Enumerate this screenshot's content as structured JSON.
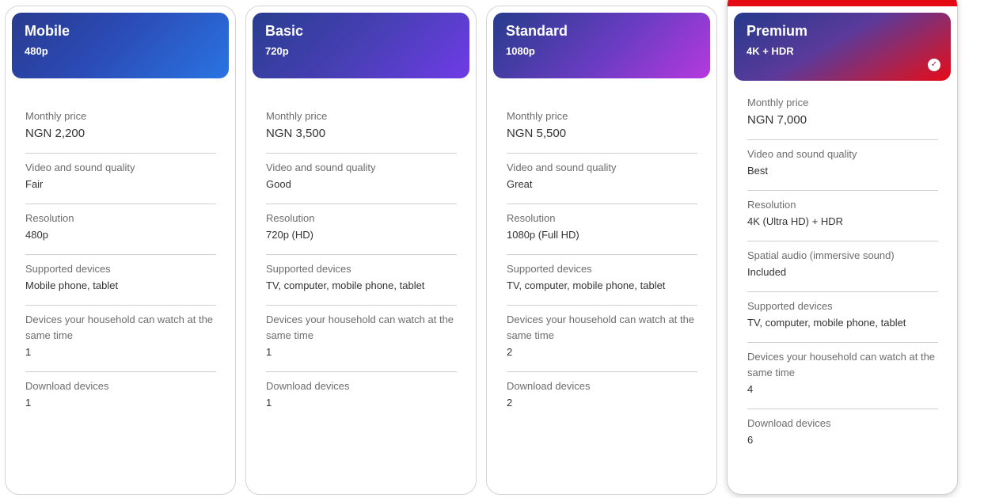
{
  "plans": [
    {
      "name": "Mobile",
      "sub": "480p",
      "price_label": "Monthly price",
      "price": "NGN 2,200",
      "rows": [
        {
          "label": "Video and sound quality",
          "value": "Fair"
        },
        {
          "label": "Resolution",
          "value": "480p"
        },
        {
          "label": "Supported devices",
          "value": "Mobile phone, tablet"
        },
        {
          "label": "Devices your household can watch at the same time",
          "value": "1"
        },
        {
          "label": "Download devices",
          "value": "1"
        }
      ]
    },
    {
      "name": "Basic",
      "sub": "720p",
      "price_label": "Monthly price",
      "price": "NGN 3,500",
      "rows": [
        {
          "label": "Video and sound quality",
          "value": "Good"
        },
        {
          "label": "Resolution",
          "value": "720p (HD)"
        },
        {
          "label": "Supported devices",
          "value": "TV, computer, mobile phone, tablet"
        },
        {
          "label": "Devices your household can watch at the same time",
          "value": "1"
        },
        {
          "label": "Download devices",
          "value": "1"
        }
      ]
    },
    {
      "name": "Standard",
      "sub": "1080p",
      "price_label": "Monthly price",
      "price": "NGN 5,500",
      "rows": [
        {
          "label": "Video and sound quality",
          "value": "Great"
        },
        {
          "label": "Resolution",
          "value": "1080p (Full HD)"
        },
        {
          "label": "Supported devices",
          "value": "TV, computer, mobile phone, tablet"
        },
        {
          "label": "Devices your household can watch at the same time",
          "value": "2"
        },
        {
          "label": "Download devices",
          "value": "2"
        }
      ]
    },
    {
      "name": "Premium",
      "sub": "4K + HDR",
      "selected": true,
      "selected_icon": "check-circle-icon",
      "price_label": "Monthly price",
      "price": "NGN 7,000",
      "rows": [
        {
          "label": "Video and sound quality",
          "value": "Best"
        },
        {
          "label": "Resolution",
          "value": "4K (Ultra HD) + HDR"
        },
        {
          "label": "Spatial audio (immersive sound)",
          "value": "Included"
        },
        {
          "label": "Supported devices",
          "value": "TV, computer, mobile phone, tablet"
        },
        {
          "label": "Devices your household can watch at the same time",
          "value": "4"
        },
        {
          "label": "Download devices",
          "value": "6"
        }
      ]
    }
  ],
  "colors": {
    "accent_red": "#e50914",
    "border": "#d4d4d4"
  }
}
